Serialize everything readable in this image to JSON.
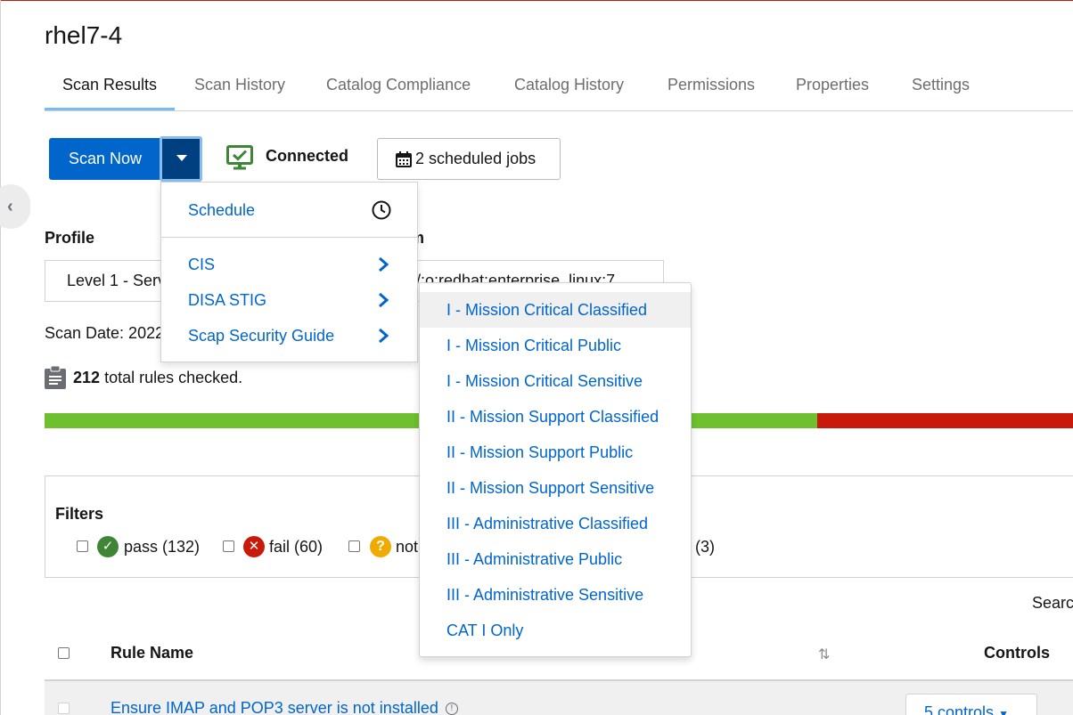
{
  "page": {
    "title": "rhel7-4"
  },
  "tabs": [
    {
      "label": "Scan Results",
      "active": true
    },
    {
      "label": "Scan History"
    },
    {
      "label": "Catalog Compliance"
    },
    {
      "label": "Catalog History"
    },
    {
      "label": "Permissions"
    },
    {
      "label": "Properties"
    },
    {
      "label": "Settings"
    }
  ],
  "toolbar": {
    "scan_now_label": "Scan Now",
    "connection_status": "Connected",
    "scheduled_jobs_label": "2 scheduled jobs"
  },
  "profile": {
    "label": "Profile",
    "value": "Level 1 - Serv"
  },
  "platform": {
    "label_partial": "rm",
    "value": "/:o:redhat:enterprise_linux:7"
  },
  "scan_date_label": "Scan Date: 2022",
  "rules_summary": {
    "count": "212",
    "text": "total rules checked."
  },
  "colors": {
    "pass": "#6ec02e",
    "fail": "#c9190b",
    "primary": "#0066cc",
    "notchecked": "#f0ab00"
  },
  "progress": {
    "pass_fraction": 0.7517,
    "fail_fraction": 0.2483
  },
  "filters": {
    "title": "Filters",
    "items": [
      {
        "label": "pass (132)"
      },
      {
        "label": "fail (60)"
      },
      {
        "label": "not"
      },
      {
        "label": ". (3)"
      }
    ]
  },
  "search_label": "Searc",
  "table": {
    "col_rule_name": "Rule Name",
    "col_controls": "Controls",
    "rows": [
      {
        "rule": "Ensure IMAP and POP3 server is not installed",
        "controls": "5 controls"
      }
    ]
  },
  "scan_menu": {
    "schedule_label": "Schedule",
    "items": [
      {
        "label": "CIS"
      },
      {
        "label": "DISA STIG"
      },
      {
        "label": "Scap Security Guide"
      }
    ]
  },
  "stig_submenu": [
    "I - Mission Critical Classified",
    "I - Mission Critical Public",
    "I - Mission Critical Sensitive",
    "II - Mission Support Classified",
    "II - Mission Support Public",
    "II - Mission Support Sensitive",
    "III - Administrative Classified",
    "III - Administrative Public",
    "III - Administrative Sensitive",
    "CAT I Only"
  ]
}
